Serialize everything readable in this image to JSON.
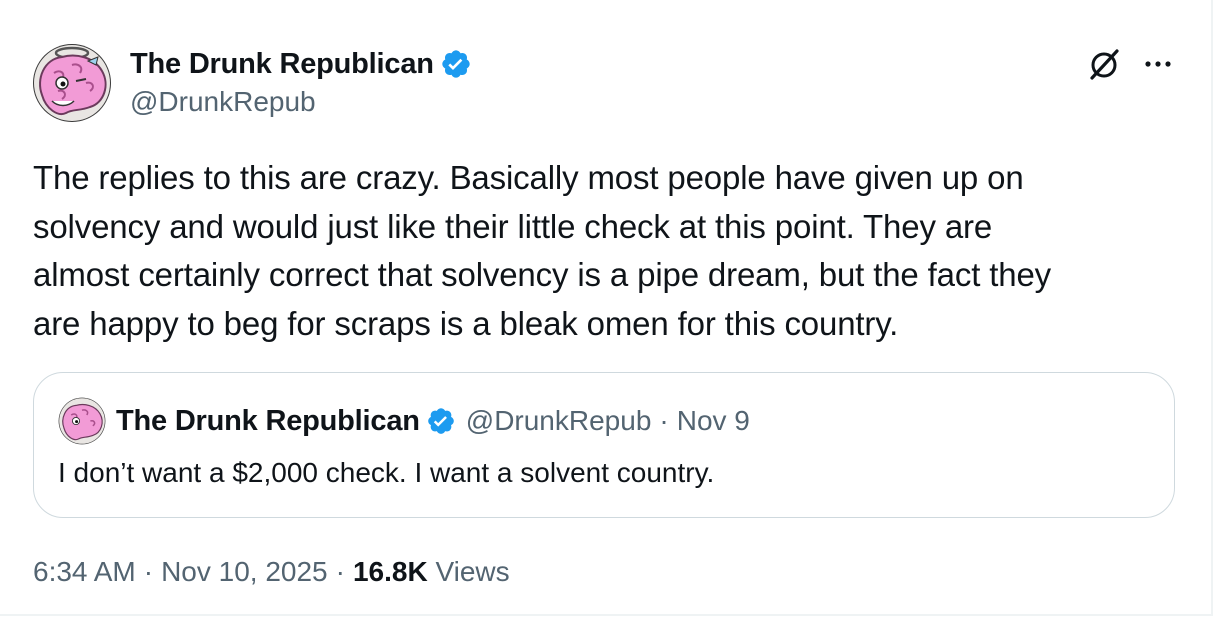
{
  "author": {
    "display_name": "The Drunk Republican",
    "handle": "@DrunkRepub",
    "avatar_icon": "pink-brain-avatar-icon",
    "verified_icon": "verified-badge-icon",
    "verified_color": "#1d9bf0"
  },
  "header_actions": {
    "grok_icon": "grok-icon",
    "more_icon": "more-icon"
  },
  "tweet": {
    "text": "The replies to this are crazy. Basically most people have given up on\nsolvency and would just like their little check at this point. They are\nalmost certainly correct that solvency is a pipe dream, but the fact they\nare happy to beg for scraps is a bleak omen for this country."
  },
  "quote": {
    "display_name": "The Drunk Republican",
    "handle": "@DrunkRepub",
    "separator": "·",
    "date": "Nov 9",
    "text": "I don’t want a $2,000 check. I want a solvent country."
  },
  "meta": {
    "time": "6:34 AM",
    "separator": "·",
    "date": "Nov 10, 2025",
    "views_count": "16.8K",
    "views_label": "Views"
  },
  "colors": {
    "text_primary": "#0f1419",
    "text_secondary": "#536471",
    "border": "#cfd9de",
    "avatar_pink": "#f29bd6"
  }
}
